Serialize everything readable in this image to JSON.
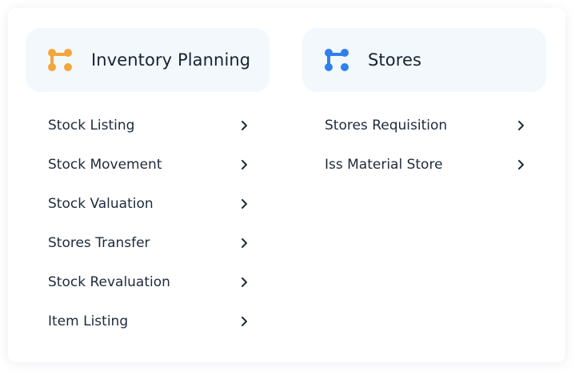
{
  "sections": [
    {
      "title": "Inventory Planning",
      "icon": "flow-nodes-icon",
      "icon_color": "#f5a53a",
      "items": [
        {
          "label": "Stock Listing"
        },
        {
          "label": "Stock Movement"
        },
        {
          "label": "Stock Valuation"
        },
        {
          "label": "Stores Transfer"
        },
        {
          "label": "Stock Revaluation"
        },
        {
          "label": "Item Listing"
        }
      ]
    },
    {
      "title": "Stores",
      "icon": "flow-nodes-icon",
      "icon_color": "#2f80ed",
      "items": [
        {
          "label": "Stores Requisition"
        },
        {
          "label": "Iss Material Store"
        }
      ]
    }
  ],
  "colors": {
    "header_bg": "#f3f8fd",
    "text": "#1f2a3a",
    "chevron": "#1f2a3a"
  }
}
